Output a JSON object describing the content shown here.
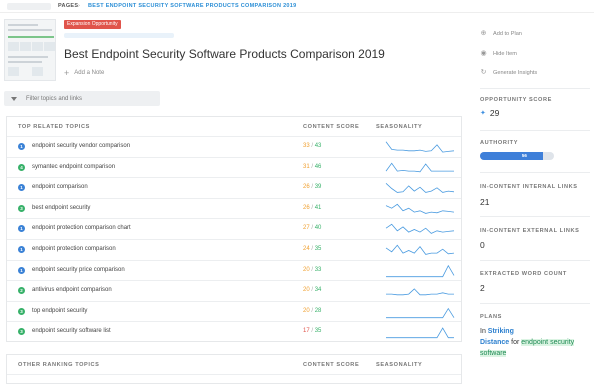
{
  "breadcrumb": {
    "pages": "PAGES",
    "separator": "›",
    "current": "BEST ENDPOINT SECURITY SOFTWARE PRODUCTS COMPARISON 2019"
  },
  "page": {
    "badge": "Expansion Opportunity",
    "title": "Best Endpoint Security Software Products Comparison 2019",
    "add_note": "Add a Note"
  },
  "filter": {
    "placeholder": "Filter topics and links"
  },
  "related": {
    "headers": {
      "topic": "TOP RELATED TOPICS",
      "score": "CONTENT SCORE",
      "seasonality": "SEASONALITY"
    },
    "rows": [
      {
        "rank": "1",
        "topic": "endpoint security vendor comparison",
        "score": "33",
        "max": "43",
        "rank_color": "#3b82d6",
        "score_color": "#f0a030",
        "season": [
          0.95,
          0.35,
          0.3,
          0.3,
          0.25,
          0.25,
          0.3,
          0.2,
          0.25,
          0.7,
          0.15,
          0.2,
          0.25
        ]
      },
      {
        "rank": "4",
        "topic": "symantec endpoint comparison",
        "score": "31",
        "max": "46",
        "rank_color": "#37b169",
        "score_color": "#f0a030",
        "season": [
          0.3,
          0.9,
          0.3,
          0.35,
          0.3,
          0.3,
          0.25,
          0.85,
          0.3,
          0.3,
          0.3,
          0.3,
          0.3
        ]
      },
      {
        "rank": "1",
        "topic": "endpoint comparison",
        "score": "26",
        "max": "39",
        "rank_color": "#3b82d6",
        "score_color": "#f0a030",
        "season": [
          0.9,
          0.5,
          0.2,
          0.25,
          0.7,
          0.3,
          0.6,
          0.2,
          0.3,
          0.55,
          0.2,
          0.3,
          0.25
        ]
      },
      {
        "rank": "3",
        "topic": "best endpoint security",
        "score": "26",
        "max": "41",
        "rank_color": "#37b169",
        "score_color": "#f0a030",
        "season": [
          0.8,
          0.6,
          0.9,
          0.4,
          0.6,
          0.3,
          0.4,
          0.2,
          0.3,
          0.25,
          0.4,
          0.35,
          0.3
        ]
      },
      {
        "rank": "1",
        "topic": "endpoint protection comparison chart",
        "score": "27",
        "max": "40",
        "rank_color": "#3b82d6",
        "score_color": "#f0a030",
        "season": [
          0.6,
          0.9,
          0.4,
          0.7,
          0.3,
          0.5,
          0.3,
          0.6,
          0.2,
          0.4,
          0.3,
          0.35,
          0.4
        ]
      },
      {
        "rank": "1",
        "topic": "endpoint protection comparison",
        "score": "24",
        "max": "35",
        "rank_color": "#3b82d6",
        "score_color": "#f0a030",
        "season": [
          0.7,
          0.4,
          0.9,
          0.3,
          0.5,
          0.3,
          0.8,
          0.2,
          0.3,
          0.3,
          0.6,
          0.25,
          0.3
        ]
      },
      {
        "rank": "1",
        "topic": "endpoint security price comparison",
        "score": "20",
        "max": "33",
        "rank_color": "#3b82d6",
        "score_color": "#f0a030",
        "season": [
          0.1,
          0.1,
          0.1,
          0.1,
          0.1,
          0.1,
          0.1,
          0.1,
          0.1,
          0.1,
          0.1,
          0.95,
          0.2
        ]
      },
      {
        "rank": "2",
        "topic": "antivirus endpoint comparison",
        "score": "20",
        "max": "34",
        "rank_color": "#37b169",
        "score_color": "#f0a030",
        "season": [
          0.3,
          0.3,
          0.25,
          0.25,
          0.3,
          0.7,
          0.25,
          0.25,
          0.3,
          0.3,
          0.4,
          0.3,
          0.3
        ]
      },
      {
        "rank": "3",
        "topic": "top endpoint security",
        "score": "20",
        "max": "28",
        "rank_color": "#37b169",
        "score_color": "#f0a030",
        "season": [
          0.1,
          0.1,
          0.1,
          0.1,
          0.1,
          0.1,
          0.1,
          0.1,
          0.1,
          0.1,
          0.1,
          0.8,
          0.1
        ]
      },
      {
        "rank": "3",
        "topic": "endpoint security software list",
        "score": "17",
        "max": "35",
        "rank_color": "#37b169",
        "score_color": "#e0544b",
        "season": [
          0.1,
          0.1,
          0.1,
          0.1,
          0.1,
          0.1,
          0.1,
          0.1,
          0.1,
          0.1,
          0.85,
          0.1,
          0.1
        ]
      }
    ]
  },
  "other": {
    "headers": {
      "topic": "OTHER RANKING TOPICS",
      "score": "CONTENT SCORE",
      "seasonality": "SEASONALITY"
    }
  },
  "sidebar": {
    "add_to_plan": "Add to Plan",
    "hide_item": "Hide Item",
    "generate_insights": "Generate Insights",
    "opportunity_label": "OPPORTUNITY SCORE",
    "opportunity_value": "29",
    "authority_label": "AUTHORITY",
    "authority_value": "56",
    "authority_fraction": 0.85,
    "internal_links_label": "IN-CONTENT INTERNAL LINKS",
    "internal_links_value": "21",
    "external_links_label": "IN-CONTENT EXTERNAL LINKS",
    "external_links_value": "0",
    "word_count_label": "EXTRACTED WORD COUNT",
    "word_count_value": "2",
    "plans_label": "PLANS",
    "plans_in": "In",
    "plans_striking": "Striking",
    "plans_distance": "Distance",
    "plans_for": "for",
    "plans_topic": "endpoint security software"
  },
  "colors": {
    "accent": "#3e7fd9",
    "badge": "#e0544b",
    "spark": "#4a9be0"
  }
}
